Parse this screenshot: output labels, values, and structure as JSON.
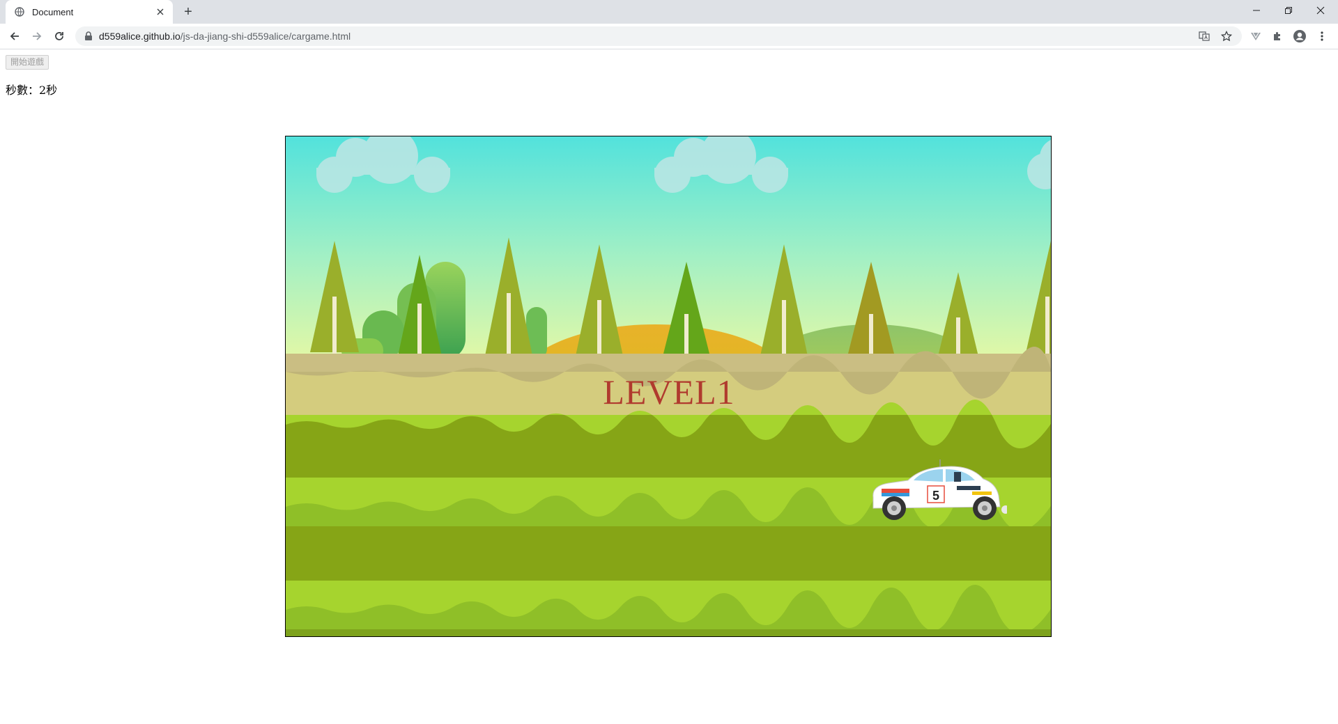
{
  "browser": {
    "tab_title": "Document",
    "new_tab_symbol": "+",
    "url_host": "d559alice.github.io",
    "url_path": "/js-da-jiang-shi-d559alice/cargame.html",
    "icons": [
      "globe-icon",
      "close-icon",
      "back-icon",
      "forward-icon",
      "reload-icon",
      "lock-icon",
      "translate-icon",
      "star-icon",
      "extension-v-icon",
      "puzzle-icon",
      "profile-icon",
      "menu-dots-icon",
      "minimize-icon",
      "restore-icon",
      "window-close-icon"
    ]
  },
  "page": {
    "start_button_label": "開始遊戲",
    "seconds_text": "秒數：2秒"
  },
  "game": {
    "level_text": "LEVEL1",
    "car_number": "5",
    "colors": {
      "sky_top": "#55e0d8",
      "sky_bottom": "#d8f5a8",
      "dirt": "#d4cc7e",
      "grass_dark": "#86a516",
      "grass_light": "#a6d42e",
      "level_text": "#b03a2e"
    }
  }
}
